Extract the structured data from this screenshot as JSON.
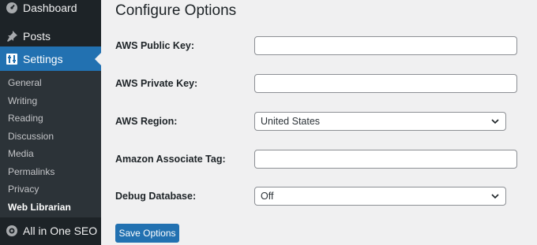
{
  "sidebar": {
    "dashboard_label": "Dashboard",
    "dashboard_icon": "gauge-icon",
    "posts_label": "Posts",
    "posts_icon": "pushpin-icon",
    "settings_label": "Settings",
    "settings_icon": "sliders-icon",
    "submenu": [
      "General",
      "Writing",
      "Reading",
      "Discussion",
      "Media",
      "Permalinks",
      "Privacy",
      "Web Librarian"
    ],
    "current_submenu": "Web Librarian",
    "seo_label": "All in One SEO",
    "seo_icon": "seo-gear-icon"
  },
  "main": {
    "title": "Configure Options",
    "fields": {
      "public_key": {
        "label": "AWS Public Key:",
        "value": ""
      },
      "private_key": {
        "label": "AWS Private Key:",
        "value": ""
      },
      "region": {
        "label": "AWS Region:",
        "value": "United States"
      },
      "associate_tag": {
        "label": "Amazon Associate Tag:",
        "value": ""
      },
      "debug_db": {
        "label": "Debug Database:",
        "value": "Off"
      }
    },
    "save_label": "Save Options"
  },
  "colors": {
    "sidebar_bg": "#1d2327",
    "submenu_bg": "#2c3338",
    "accent": "#2271b1",
    "page_bg": "#f0f0f1"
  }
}
